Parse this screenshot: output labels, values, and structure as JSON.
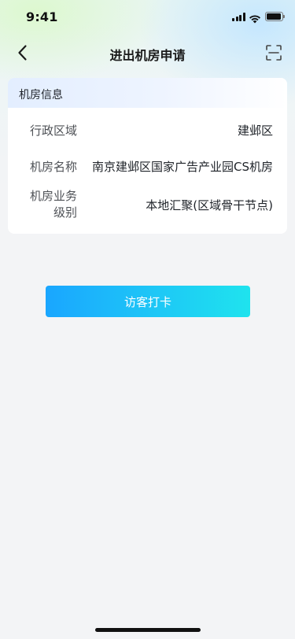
{
  "status_bar": {
    "time": "9:41",
    "icons": [
      "signal-icon",
      "wifi-icon",
      "battery-icon"
    ]
  },
  "nav": {
    "title": "进出机房申请",
    "back_icon": "chevron-left-icon",
    "scan_icon": "scan-icon"
  },
  "card": {
    "title": "机房信息",
    "rows": [
      {
        "label": "行政区域",
        "value": "建邺区"
      },
      {
        "label": "机房名称",
        "value": "南京建邺区国家广告产业园CS机房"
      },
      {
        "label_line1": "机房业务",
        "label_line2": "级别",
        "value": "本地汇聚(区域骨干节点)"
      }
    ]
  },
  "action": {
    "label": "访客打卡"
  },
  "colors": {
    "button_gradient_start": "#1aa6ff",
    "button_gradient_end": "#1fe3ee",
    "page_background": "#f3f4f6",
    "card_background": "#ffffff"
  }
}
